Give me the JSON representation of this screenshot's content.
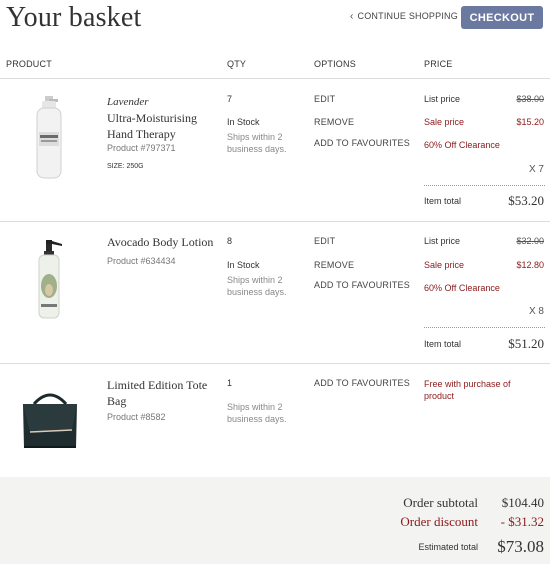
{
  "header": {
    "title": "Your basket",
    "continue_label": "CONTINUE SHOPPING",
    "checkout_label": "CHECKOUT"
  },
  "columns": {
    "product": "PRODUCT",
    "qty": "QTY",
    "options": "OPTIONS",
    "price": "PRICE"
  },
  "items": [
    {
      "brand": "Lavender",
      "name_line1": "Ultra-Moisturising",
      "name_line2": "Hand Therapy",
      "product_number": "Product #797371",
      "size": "SIZE: 250G",
      "qty": "7",
      "stock": "In Stock",
      "ships": "Ships within 2 business days.",
      "options": [
        "EDIT",
        "REMOVE",
        "ADD TO FAVOURITES"
      ],
      "list_price_label": "List price",
      "list_price": "$38.00",
      "sale_price_label": "Sale price",
      "sale_price": "$15.20",
      "clearance": "60% Off Clearance",
      "times": "X 7",
      "item_total_label": "Item total",
      "item_total": "$53.20"
    },
    {
      "name_line1": "Avocado Body Lotion",
      "product_number": "Product #634434",
      "qty": "8",
      "stock": "In Stock",
      "ships": "Ships within 2 business days.",
      "options": [
        "EDIT",
        "REMOVE",
        "ADD TO FAVOURITES"
      ],
      "list_price_label": "List price",
      "list_price": "$32.00",
      "sale_price_label": "Sale price",
      "sale_price": "$12.80",
      "clearance": "60% Off Clearance",
      "times": "X 8",
      "item_total_label": "Item total",
      "item_total": "$51.20"
    },
    {
      "name_line1": "Limited Edition Tote",
      "name_line2": "Bag",
      "product_number": "Product #8582",
      "qty": "1",
      "ships": "Ships within 2 business days.",
      "options": [
        "ADD TO FAVOURITES"
      ],
      "free_note": "Free with purchase of product"
    }
  ],
  "summary": {
    "subtotal_label": "Order subtotal",
    "subtotal": "$104.40",
    "discount_label": "Order discount",
    "discount": "- $31.32",
    "total_label": "Estimated total",
    "total": "$73.08"
  },
  "colors": {
    "checkout_bg": "#6b78a0",
    "sale_red": "#8b1a1a",
    "footer_bg": "#f3f3f1"
  }
}
